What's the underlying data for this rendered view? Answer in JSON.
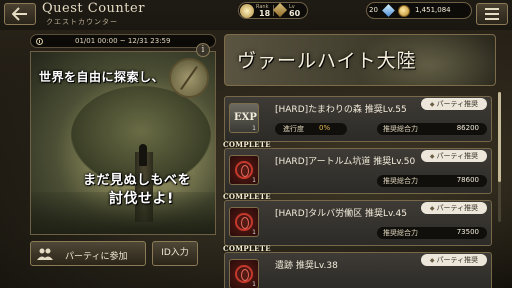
{
  "header": {
    "title": "Quest Counter",
    "subtitle": "クエストカウンター",
    "rank_label": "Rank",
    "rank_value": "18",
    "lv_label": "Lv",
    "lv_value": "60",
    "gems": "20",
    "coins": "1,451,084"
  },
  "event": {
    "period": "01/01 00:00 ~ 12/31 23:59",
    "info": "i",
    "banner_line1": "世界を自由に探索し、",
    "banner_line2": "まだ見ぬしもべを",
    "banner_line3": "討伐せよ!"
  },
  "buttons": {
    "party_join": "パーティに参加",
    "id_input": "ID入力"
  },
  "region": {
    "title": "ヴァールハイト大陸"
  },
  "quests": [
    {
      "complete": "",
      "name": "[HARD]たまわりの森 推奨Lv.55",
      "party_tag": "パーティ推奨",
      "icon_label": "EXP",
      "icon_num": "1",
      "progress_label": "進行度",
      "progress_value": "0%",
      "power_label": "推奨総合力",
      "power_value": "86200"
    },
    {
      "complete": "COMPLETE",
      "name": "[HARD]アートルム坑道 推奨Lv.50",
      "party_tag": "パーティ推奨",
      "icon_num": "1",
      "power_label": "推奨総合力",
      "power_value": "78600"
    },
    {
      "complete": "COMPLETE",
      "name": "[HARD]タルバ労働区 推奨Lv.45",
      "party_tag": "パーティ推奨",
      "icon_num": "1",
      "power_label": "推奨総合力",
      "power_value": "73500"
    },
    {
      "complete": "COMPLETE",
      "name": "遺跡 推奨Lv.38",
      "party_tag": "パーティ推奨",
      "icon_num": "1"
    }
  ],
  "colors": {
    "accent_gold": "#e6b94a",
    "frame": "#766848",
    "tag_bg": "#ece7da"
  }
}
